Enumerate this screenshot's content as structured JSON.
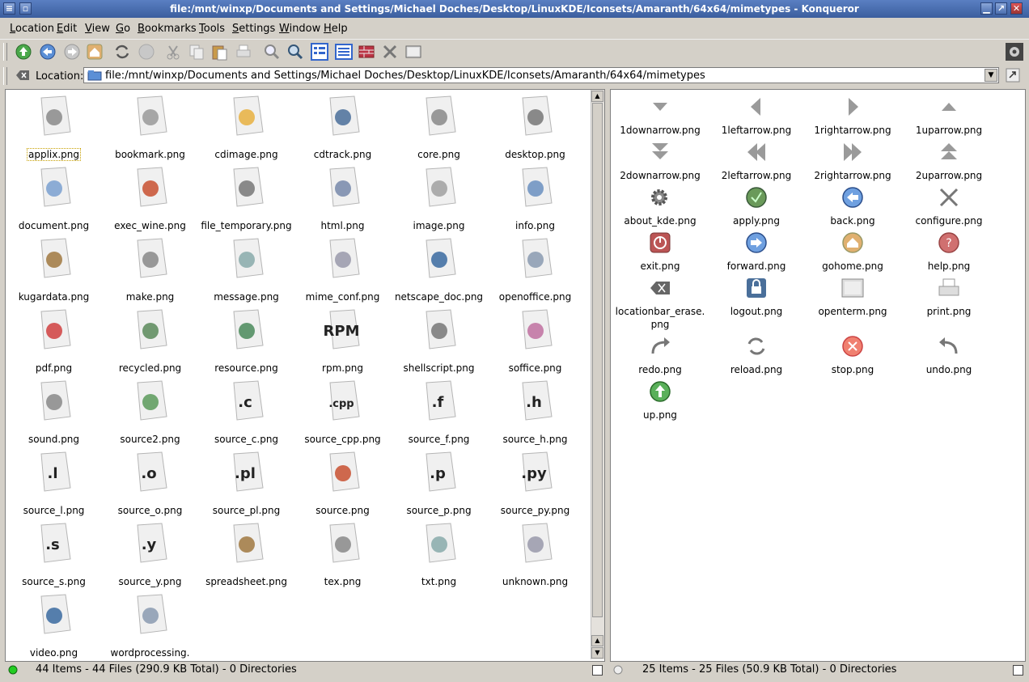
{
  "window": {
    "title": "file:/mnt/winxp/Documents and Settings/Michael Doches/Desktop/LinuxKDE/Iconsets/Amaranth/64x64/mimetypes - Konqueror"
  },
  "menu": [
    "Location",
    "Edit",
    "View",
    "Go",
    "Bookmarks",
    "Tools",
    "Settings",
    "Window",
    "Help"
  ],
  "menu_underline": [
    "L",
    "E",
    "V",
    "G",
    "B",
    "T",
    "S",
    "W",
    "H"
  ],
  "location": {
    "label": "Location:",
    "url": "file:/mnt/winxp/Documents and Settings/Michael Doches/Desktop/LinuxKDE/Iconsets/Amaranth/64x64/mimetypes"
  },
  "left_panel": {
    "files": [
      "applix.png",
      "bookmark.png",
      "cdimage.png",
      "cdtrack.png",
      "core.png",
      "desktop.png",
      "document.png",
      "exec_wine.png",
      "file_temporary.png",
      "html.png",
      "image.png",
      "info.png",
      "kugardata.png",
      "make.png",
      "message.png",
      "mime_conf.png",
      "netscape_doc.png",
      "openoffice.png",
      "pdf.png",
      "recycled.png",
      "resource.png",
      "rpm.png",
      "shellscript.png",
      "soffice.png",
      "sound.png",
      "source2.png",
      "source_c.png",
      "source_cpp.png",
      "source_f.png",
      "source_h.png",
      "source_l.png",
      "source_o.png",
      "source_pl.png",
      "source.png",
      "source_p.png",
      "source_py.png",
      "source_s.png",
      "source_y.png",
      "spreadsheet.png",
      "tex.png",
      "txt.png",
      "unknown.png",
      "video.png",
      "wordprocessing."
    ],
    "badges": {
      "source_c.png": ".c",
      "source_cpp.png": ".cpp",
      "source_f.png": ".f",
      "source_h.png": ".h",
      "source_l.png": ".l",
      "source_o.png": ".o",
      "source_pl.png": ".pl",
      "source_p.png": ".p",
      "source_py.png": ".py",
      "source_s.png": ".s",
      "source_y.png": ".y",
      "rpm.png": "RPM"
    },
    "status": "44 Items - 44 Files (290.9 KB Total) - 0 Directories"
  },
  "right_panel": {
    "files": [
      {
        "name": "1downarrow.png",
        "icon": "down-arrow-icon"
      },
      {
        "name": "1leftarrow.png",
        "icon": "left-arrow-icon"
      },
      {
        "name": "1rightarrow.png",
        "icon": "right-arrow-icon"
      },
      {
        "name": "1uparrow.png",
        "icon": "up-arrow-icon"
      },
      {
        "name": "2downarrow.png",
        "icon": "double-down-arrow-icon"
      },
      {
        "name": "2leftarrow.png",
        "icon": "double-left-arrow-icon"
      },
      {
        "name": "2rightarrow.png",
        "icon": "double-right-arrow-icon"
      },
      {
        "name": "2uparrow.png",
        "icon": "double-up-arrow-icon"
      },
      {
        "name": "about_kde.png",
        "icon": "gear-icon"
      },
      {
        "name": "apply.png",
        "icon": "apply-icon"
      },
      {
        "name": "back.png",
        "icon": "back-icon"
      },
      {
        "name": "configure.png",
        "icon": "tools-icon"
      },
      {
        "name": "exit.png",
        "icon": "power-icon"
      },
      {
        "name": "forward.png",
        "icon": "forward-icon"
      },
      {
        "name": "gohome.png",
        "icon": "home-icon"
      },
      {
        "name": "help.png",
        "icon": "help-icon"
      },
      {
        "name": "locationbar_erase.\npng",
        "icon": "erase-icon"
      },
      {
        "name": "logout.png",
        "icon": "lock-icon"
      },
      {
        "name": "openterm.png",
        "icon": "terminal-icon"
      },
      {
        "name": "print.png",
        "icon": "printer-icon"
      },
      {
        "name": "redo.png",
        "icon": "redo-icon"
      },
      {
        "name": "reload.png",
        "icon": "reload-icon"
      },
      {
        "name": "stop.png",
        "icon": "stop-icon"
      },
      {
        "name": "undo.png",
        "icon": "undo-icon"
      },
      {
        "name": "up.png",
        "icon": "up-icon"
      }
    ],
    "status": "25 Items - 25 Files (50.9 KB Total) - 0 Directories"
  }
}
